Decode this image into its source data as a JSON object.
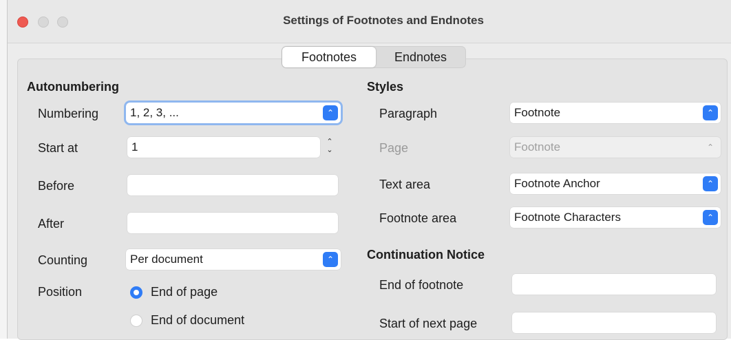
{
  "window": {
    "title": "Settings of Footnotes and Endnotes"
  },
  "tabs": [
    {
      "label": "Footnotes"
    },
    {
      "label": "Endnotes"
    }
  ],
  "autonumbering": {
    "heading": "Autonumbering",
    "numbering": {
      "label": "Numbering",
      "value": "1, 2, 3, ..."
    },
    "start_at": {
      "label": "Start at",
      "value": "1"
    },
    "before": {
      "label": "Before",
      "value": ""
    },
    "after": {
      "label": "After",
      "value": ""
    },
    "counting": {
      "label": "Counting",
      "value": "Per document"
    },
    "position": {
      "label": "Position",
      "options": [
        {
          "label": "End of page",
          "selected": true
        },
        {
          "label": "End of document",
          "selected": false
        }
      ]
    }
  },
  "styles": {
    "heading": "Styles",
    "paragraph": {
      "label": "Paragraph",
      "value": "Footnote"
    },
    "page": {
      "label": "Page",
      "value": "Footnote"
    },
    "text_area": {
      "label": "Text area",
      "value": "Footnote Anchor"
    },
    "footnote_area": {
      "label": "Footnote area",
      "value": "Footnote Characters"
    }
  },
  "continuation": {
    "heading": "Continuation Notice",
    "end_of_footnote": {
      "label": "End of footnote",
      "value": ""
    },
    "start_of_next_page": {
      "label": "Start of next page",
      "value": ""
    }
  },
  "colors": {
    "accent": "#2f7cf6",
    "close": "#ee5a52",
    "focus_ring": "#8fb7ef"
  },
  "icons": {
    "dropdown": "up-down-chevron-icon",
    "spin": "spin-arrows-icon",
    "close": "close-icon",
    "minimize": "minimize-icon",
    "maximize": "maximize-icon"
  }
}
